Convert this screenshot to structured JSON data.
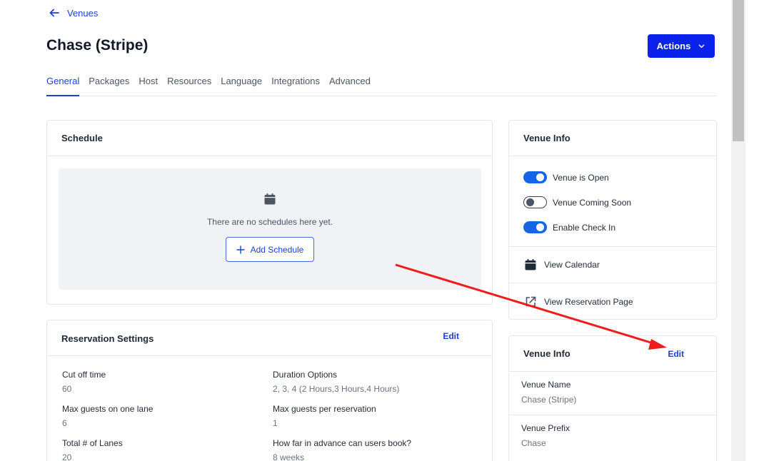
{
  "nav": {
    "back_label": "Venues"
  },
  "page": {
    "title": "Chase (Stripe)",
    "actions_label": "Actions"
  },
  "tabs": [
    {
      "label": "General"
    },
    {
      "label": "Packages"
    },
    {
      "label": "Host"
    },
    {
      "label": "Resources"
    },
    {
      "label": "Language"
    },
    {
      "label": "Integrations"
    },
    {
      "label": "Advanced"
    }
  ],
  "schedule": {
    "title": "Schedule",
    "empty_text": "There are no schedules here yet.",
    "add_label": "Add Schedule"
  },
  "reservation": {
    "title": "Reservation Settings",
    "edit_label": "Edit",
    "items": [
      {
        "label": "Cut off time",
        "value": "60"
      },
      {
        "label": "Duration Options",
        "value": "2, 3, 4 (2 Hours,3 Hours,4 Hours)"
      },
      {
        "label": "Max guests on one lane",
        "value": "6"
      },
      {
        "label": "Max guests per reservation",
        "value": "1"
      },
      {
        "label": "Total # of Lanes",
        "value": "20"
      },
      {
        "label": "How far in advance can users book?",
        "value": "8 weeks"
      }
    ]
  },
  "venue_info": {
    "title": "Venue Info",
    "toggles": [
      {
        "label": "Venue is Open",
        "on": true
      },
      {
        "label": "Venue Coming Soon",
        "on": false
      },
      {
        "label": "Enable Check In",
        "on": true
      }
    ],
    "links": [
      {
        "label": "View Calendar",
        "icon": "calendar-icon"
      },
      {
        "label": "View Reservation Page",
        "icon": "external-link-icon"
      }
    ]
  },
  "venue_details": {
    "title": "Venue Info",
    "edit_label": "Edit",
    "items": [
      {
        "label": "Venue Name",
        "value": "Chase (Stripe)"
      },
      {
        "label": "Venue Prefix",
        "value": "Chase"
      }
    ]
  },
  "colors": {
    "accent": "#0a22ec",
    "link": "#1d3fd8",
    "toggle_on": "#1565e6",
    "annotation_arrow": "#ee1c1c"
  }
}
